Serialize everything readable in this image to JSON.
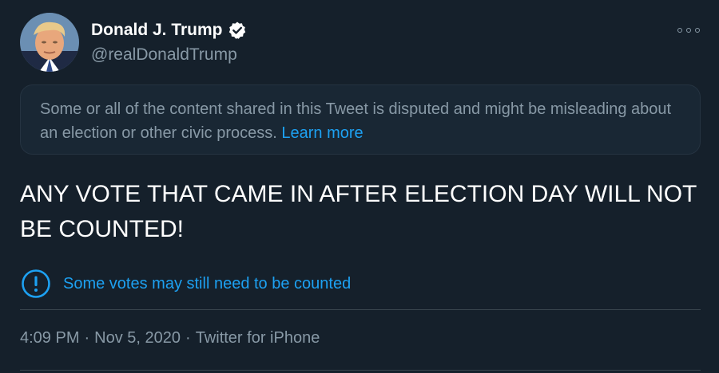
{
  "author": {
    "display_name": "Donald J. Trump",
    "handle": "@realDonaldTrump",
    "verified": true
  },
  "notice": {
    "text": "Some or all of the content shared in this Tweet is disputed and might be misleading about an election or other civic process.",
    "link": "Learn more"
  },
  "tweet": {
    "text": "ANY VOTE THAT CAME IN AFTER ELECTION DAY WILL NOT BE COUNTED!"
  },
  "label": {
    "icon": "exclamation-circle-icon",
    "text": "Some votes may still need to be counted"
  },
  "meta": {
    "time": "4:09 PM",
    "date": "Nov 5, 2020",
    "source": "Twitter for iPhone",
    "separator": "·"
  },
  "colors": {
    "background": "#15202b",
    "accent": "#1da1f2",
    "secondary_text": "#8899a6",
    "primary_text": "#ffffff"
  }
}
